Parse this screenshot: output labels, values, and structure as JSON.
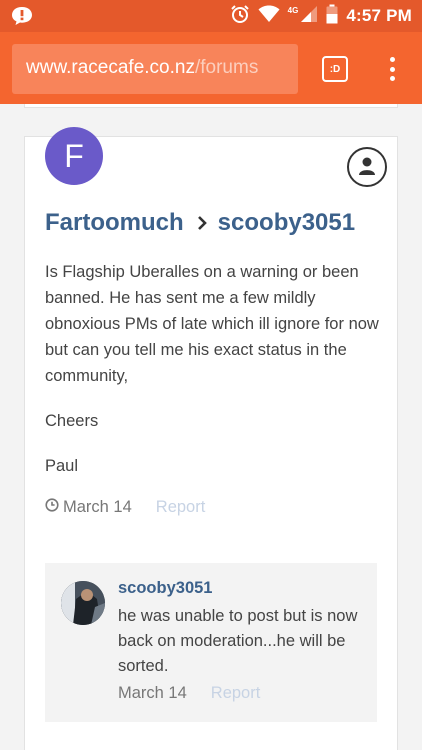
{
  "status_bar": {
    "time": "4:57 PM",
    "network": "4G",
    "icons": [
      "chat-notification-icon",
      "alarm-icon",
      "wifi-icon",
      "signal-icon",
      "battery-icon"
    ]
  },
  "browser": {
    "url_main": "www.racecafe.co.nz",
    "url_rest": "/forums",
    "tab_label": ":D",
    "toolbar_color": "#f4652f",
    "status_color": "#e4592b"
  },
  "post": {
    "avatar_letter": "F",
    "avatar_color": "#6a5ac9",
    "from_user": "Fartoomuch",
    "to_user": "scooby3051",
    "paragraphs": [
      "Is Flagship Uberalles on a warning or been banned. He has sent  me a few mildly obnoxious PMs of late which ill ignore for now but can you tell me his exact status in the community,",
      "Cheers",
      "Paul"
    ],
    "date": "March 14",
    "report_label": "Report"
  },
  "reply": {
    "author": "scooby3051",
    "text": "he was unable to post but is now back on moderation...he will be sorted.",
    "date": "March 14",
    "report_label": "Report"
  }
}
